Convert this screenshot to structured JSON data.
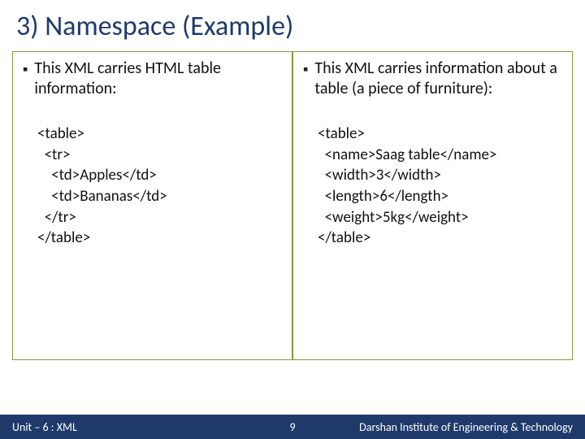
{
  "title": "3) Namespace (Example)",
  "left": {
    "bullet": "This XML carries HTML table information:",
    "code": "<table>\n  <tr>\n    <td>Apples</td>\n    <td>Bananas</td>\n  </tr>\n</table>"
  },
  "right": {
    "bullet": "This XML carries information about a table (a piece of furniture):",
    "code": "<table>\n  <name>Saag table</name>\n  <width>3</width>\n  <length>6</length>\n  <weight>5kg</weight>\n</table>"
  },
  "footer": {
    "unit": "Unit – 6 : XML",
    "page": "9",
    "org": "Darshan Institute of Engineering & Technology"
  }
}
